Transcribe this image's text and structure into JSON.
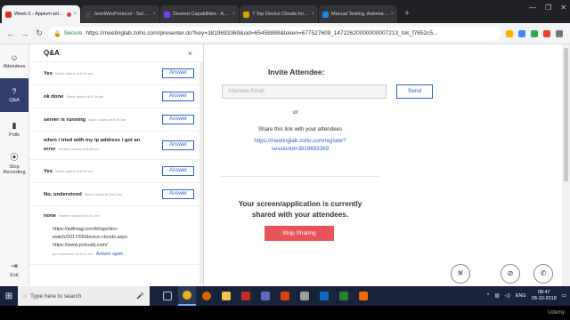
{
  "browser": {
    "tabs": [
      {
        "title": "Week 6 - Appium with Py",
        "active": true,
        "color": "#d93025"
      },
      {
        "title": "JsonWireProtocol - Seleniu",
        "active": false,
        "color": "#444444"
      },
      {
        "title": "Desired Capabilities - Appium",
        "active": false,
        "color": "#7b3ff2"
      },
      {
        "title": "7 Top Device Clouds for Mob",
        "active": false,
        "color": "#e5a100"
      },
      {
        "title": "Manual Testing, Automation",
        "active": false,
        "color": "#1e88e5"
      }
    ],
    "new_tab": "+",
    "window_controls": [
      "—",
      "❐",
      "✕"
    ],
    "secure_label": "Secure",
    "url": "https://meetinglab.zoho.com/presenter.do?key=3819693369&cid=65458888&token=677527609_14722620000000007213_tok_f7652c5..."
  },
  "leftnav": [
    {
      "id": "attendees",
      "icon": "☺",
      "label": "Attendees",
      "active": false
    },
    {
      "id": "qa",
      "icon": "?",
      "label": "Q&A",
      "active": true
    },
    {
      "id": "polls",
      "icon": "▮",
      "label": "Polls",
      "active": false
    },
    {
      "id": "stop-recording",
      "icon": "⦿",
      "label": "Stop Recording",
      "active": false
    }
  ],
  "exit": {
    "icon": "⇥",
    "label": "Exit"
  },
  "qa": {
    "title": "Q&A",
    "close": "×",
    "answer_label": "Answer",
    "questions": [
      {
        "text": "Yes",
        "meta": "Samir asked at 8:34 am"
      },
      {
        "text": "ok done",
        "meta": "Samir asked at 8:34 am"
      },
      {
        "text": "server is running",
        "meta": "Samir asked at 8:35 am"
      },
      {
        "text": "when i tried with my ip address i got an error",
        "meta": "Harleen asked at 8:36 am"
      },
      {
        "text": "Yes",
        "meta": "Samir asked at 8:38 pm"
      },
      {
        "text": "No, understood",
        "meta": "Samir asked at 8:41 am"
      },
      {
        "text": "none",
        "meta": "Harleen asked at 8:41 am"
      }
    ],
    "answer": {
      "line1": "https://adtmag.com/blogs/dev-",
      "line2": "watch/2017/05/device-clouds.aspx",
      "line3": "https://www.pcloudy.com/",
      "meta": "you answered at 8:41 am",
      "again": "Answer again"
    }
  },
  "invite": {
    "title": "Invite Attendee:",
    "email_placeholder": "Attendee Email",
    "send": "Send",
    "or": "or",
    "share_text": "Share this link with your attendees",
    "link_line1": "https://meetinglab.zoho.com/register?",
    "link_line2": "sessionId=3819693369"
  },
  "status": {
    "line1": "Your screen/application is currently",
    "line2": "shared with your attendees.",
    "stop": "Stop Sharing"
  },
  "controls": [
    "mic-off-icon",
    "video-off-icon",
    "phone-icon"
  ],
  "taskbar": {
    "search_placeholder": "Type here to search",
    "lang": "ENG",
    "time": "08:47",
    "date": "28-10-2018"
  },
  "watermark": "Udemy"
}
